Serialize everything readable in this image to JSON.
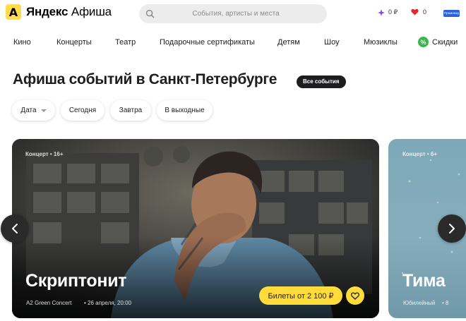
{
  "header": {
    "logo_mark": "A",
    "brand": "Яндекс",
    "product": "Афиша",
    "search_placeholder": "События, артисты и места",
    "points": "0 ₽",
    "likes": "0",
    "promo": "Промокод"
  },
  "nav": {
    "items": [
      "Кино",
      "Концерты",
      "Театр",
      "Подарочные сертификаты",
      "Детям",
      "Шоу",
      "Мюзиклы"
    ],
    "discount_label": "Скидки",
    "discount_icon": "%"
  },
  "title": "Афиша событий в Санкт-Петербурге",
  "all_events": "Все события",
  "filters": {
    "date": "Дата",
    "today": "Сегодня",
    "tomorrow": "Завтра",
    "weekend": "В выходные"
  },
  "cards": [
    {
      "tag": "Концерт • 16+",
      "title": "Скриптонит",
      "venue": "A2 Green Concert",
      "date": "26 апреля, 20:00",
      "ticket": "Билеты от 2 100 ₽"
    },
    {
      "tag": "Концерт • 6+",
      "title": "Тима",
      "venue": "Юбилейный",
      "date": "8"
    }
  ],
  "colors": {
    "accent": "#ffdc3a",
    "discount": "#3bb548",
    "points": "#8a3ffc",
    "heart": "#e5262e"
  }
}
